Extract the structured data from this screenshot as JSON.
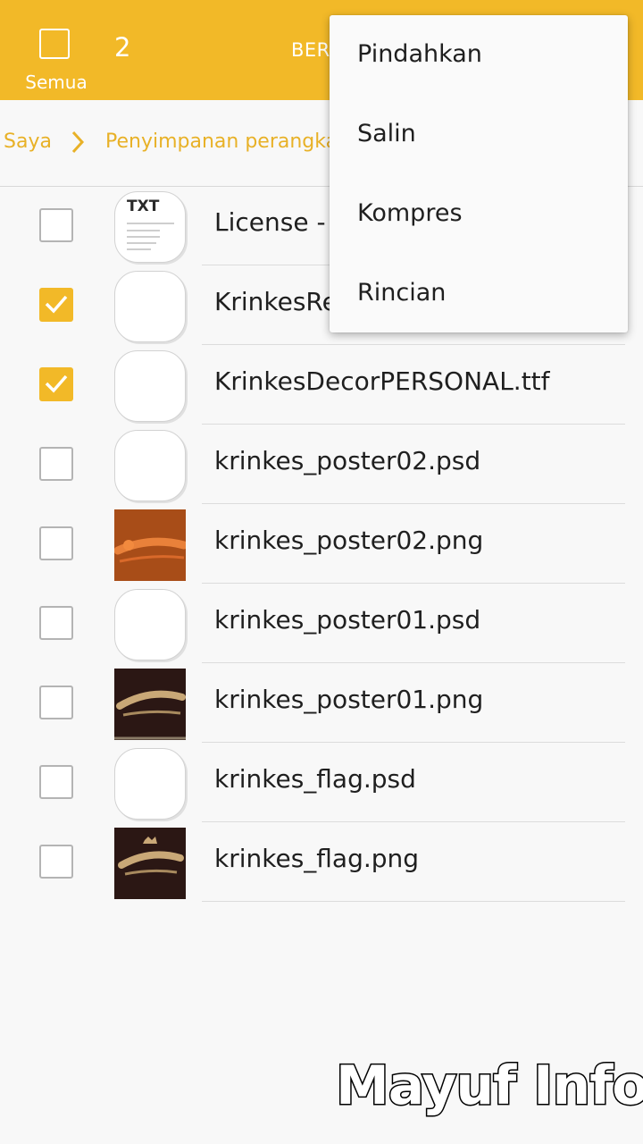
{
  "header": {
    "select_all_label": "Semua",
    "selected_count": "2",
    "share_label": "BER"
  },
  "breadcrumb": {
    "items": [
      "Saya",
      "Penyimpanan perangkat"
    ]
  },
  "files": [
    {
      "name": "License - I",
      "checked": false,
      "thumb": "txt-file-icon",
      "thumb_text": "TXT"
    },
    {
      "name": "KrinkesRe",
      "checked": true,
      "thumb": "file-icon"
    },
    {
      "name": "KrinkesDecorPERSONAL.ttf",
      "checked": true,
      "thumb": "file-icon"
    },
    {
      "name": "krinkes_poster02.psd",
      "checked": false,
      "thumb": "file-icon"
    },
    {
      "name": "krinkes_poster02.png",
      "checked": false,
      "thumb": "image-thumbnail"
    },
    {
      "name": "krinkes_poster01.psd",
      "checked": false,
      "thumb": "file-icon"
    },
    {
      "name": "krinkes_poster01.png",
      "checked": false,
      "thumb": "image-thumbnail"
    },
    {
      "name": "krinkes_flag.psd",
      "checked": false,
      "thumb": "file-icon"
    },
    {
      "name": "krinkes_flag.png",
      "checked": false,
      "thumb": "image-thumbnail"
    }
  ],
  "menu": {
    "items": [
      "Pindahkan",
      "Salin",
      "Kompres",
      "Rincian"
    ]
  },
  "watermark": "Mayuf Info",
  "colors": {
    "accent": "#f2b928",
    "breadcrumb_text": "#e8b127",
    "background": "#f8f8f8"
  }
}
